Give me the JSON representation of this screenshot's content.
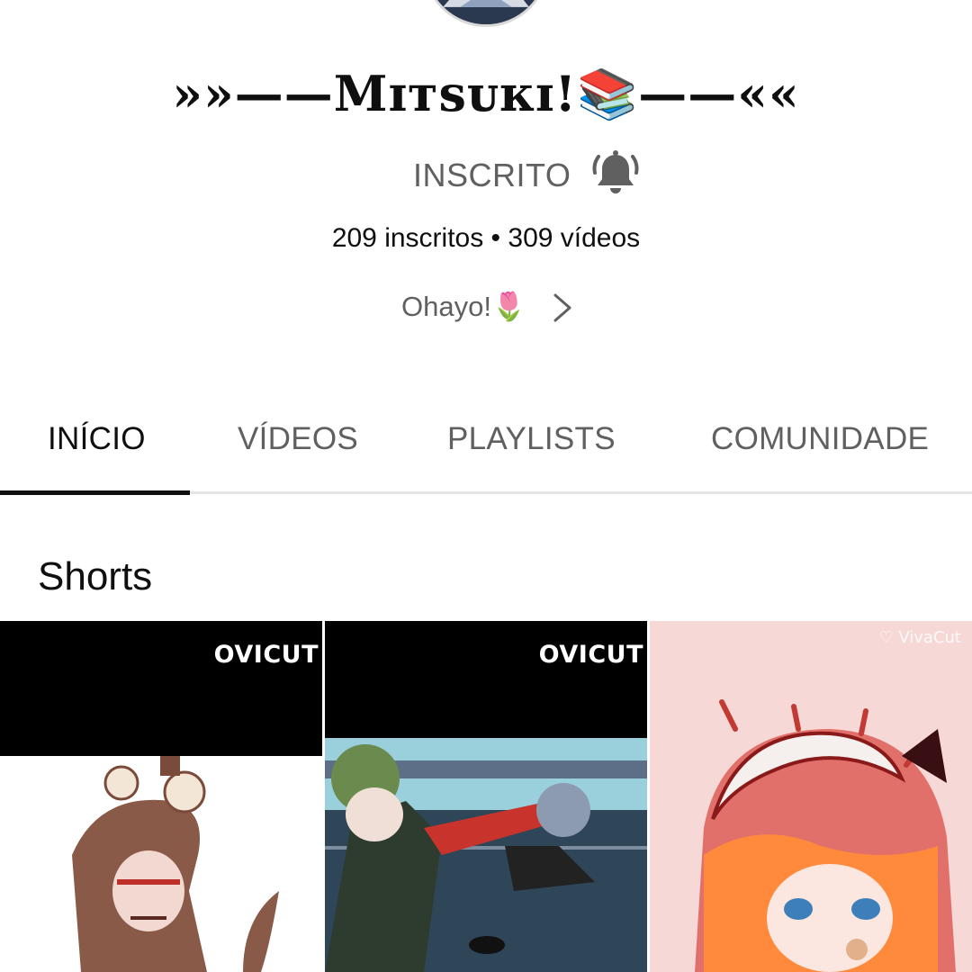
{
  "channel": {
    "name": "»»——Mɪᴛsᴜᴋɪ!📚——««",
    "subscribe_label": "INSCRITO",
    "stats": "209 inscritos • 309 vídeos",
    "about": "Ohayo!🌷"
  },
  "tabs": [
    {
      "label": "INÍCIO",
      "active": true
    },
    {
      "label": "VÍDEOS",
      "active": false
    },
    {
      "label": "PLAYLISTS",
      "active": false
    },
    {
      "label": "COMUNIDADE",
      "active": false
    }
  ],
  "shorts": {
    "title": "Shorts",
    "items": [
      {
        "watermark": "OVICUT"
      },
      {
        "watermark": "OVICUT"
      },
      {
        "watermark": "♡ VivaCut"
      }
    ]
  },
  "icons": {
    "bell": "bell-icon",
    "chevron": "chevron-right-icon"
  },
  "colors": {
    "text_primary": "#0f0f0f",
    "text_secondary": "#606060",
    "divider": "#e5e5e5"
  }
}
